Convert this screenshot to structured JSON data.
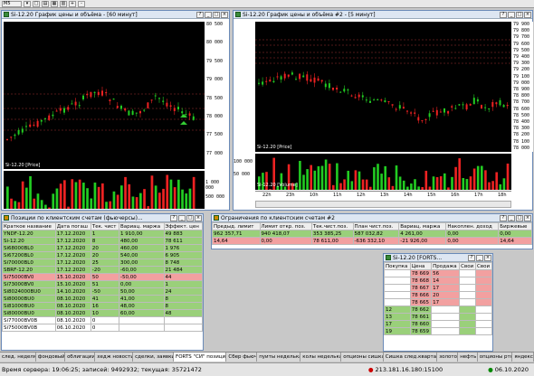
{
  "toolbar": {
    "combo": "M5"
  },
  "win1": {
    "title": "Si-12.20 График цены и объёма - [60 минут]",
    "price_label": "Si-12.20 [Price]",
    "vol_label": "Si-12.20 [Volume]",
    "axis": [
      "80 500",
      "80 000",
      "79 500",
      "79 000",
      "78 500",
      "78 000",
      "77 500",
      "77 000"
    ],
    "vol_axis": [
      "1 000 000",
      "500 000"
    ]
  },
  "win2": {
    "title": "Si-12.20 График цены и объёма #2 - [5 минут]",
    "price_label": "Si-12.20 [Price]",
    "vol_label": "Si-12.20 [Volume]",
    "axis": [
      "79 900",
      "79 800",
      "79 700",
      "79 600",
      "79 500",
      "79 400",
      "79 300",
      "79 200",
      "79 100",
      "79 000",
      "78 900",
      "78 800",
      "78 700",
      "78 600",
      "78 500",
      "78 400",
      "78 300",
      "78 200",
      "78 100",
      "78 000"
    ],
    "vol_axis": [
      "100 000",
      "50 000"
    ],
    "xticks": [
      "22h",
      "23h",
      "10h",
      "11h",
      "12h",
      "13h",
      "14h",
      "15h",
      "16h",
      "17h",
      "18h"
    ]
  },
  "positions": {
    "title": "Позиции по клиентским счетам (фьючерсы)...",
    "cols": [
      "Краткое название",
      "Дата погаш",
      "Тек. чист",
      "Вариац. маржа",
      "Эффект. цен"
    ],
    "rows": [
      [
        "YNDF-12.20",
        "17.12.2020",
        "1",
        "1 910,00",
        "49 883"
      ],
      [
        "Si-12.20",
        "17.12.2020",
        "8",
        "480,00",
        "78 611"
      ],
      [
        "Si68000BL0",
        "17.12.2020",
        "20",
        "460,00",
        "1 976"
      ],
      [
        "Si67200BL0",
        "17.12.2020",
        "20",
        "540,00",
        "6 905"
      ],
      [
        "Si70000BL0",
        "17.12.2020",
        "25",
        "300,00",
        "8 748"
      ],
      [
        "SBRF-12.20",
        "17.12.2020",
        "-20",
        "-60,00",
        "21 484"
      ],
      [
        "Si75000BV0",
        "15.10.2020",
        "50",
        "-50,00",
        "44"
      ],
      [
        "Si73000BV0",
        "15.10.2020",
        "51",
        "0,00",
        "1"
      ],
      [
        "Si8024000BU0",
        "14.10.2020",
        "-50",
        "50,00",
        "24"
      ],
      [
        "Si80000BU0",
        "08.10.2020",
        "41",
        "41,00",
        "8"
      ],
      [
        "Si81000BU0",
        "08.10.2020",
        "16",
        "48,00",
        "8"
      ],
      [
        "Si80000BU0",
        "08.10.2020",
        "10",
        "60,00",
        "48"
      ],
      [
        "Si77000BV0B",
        "08.10.2020",
        "0",
        "",
        ""
      ],
      [
        "Si75000BV0B",
        "06.10.2020",
        "0",
        "",
        ""
      ]
    ]
  },
  "limits": {
    "title": "Ограничения по клиентским счетам #2",
    "cols": [
      "Предыд. лимит",
      "Лимит откр. поз.",
      "Тек.чист.поз.",
      "План чист.поз.",
      "Вариац. маржа",
      "Накоплен. доход",
      "Биржевые"
    ],
    "rows": [
      [
        "962 357,71",
        "940 418,07",
        "353 385,25",
        "587 032,82",
        "4 261,00",
        "0,00",
        "0,00"
      ],
      [
        "14,64",
        "0,00",
        "78 611,00",
        "-636 332,10",
        "-21 926,00",
        "0,00",
        "14,64"
      ]
    ]
  },
  "dom": {
    "title": "Si-12.20 [FORTS...",
    "cols": [
      "Покупка",
      "Цена",
      "Продажа",
      "Свои",
      "Свои"
    ],
    "rows": [
      [
        "",
        "78 669",
        "56",
        "",
        ""
      ],
      [
        "",
        "78 668",
        "14",
        "",
        ""
      ],
      [
        "",
        "78 667",
        "17",
        "",
        ""
      ],
      [
        "",
        "78 666",
        "20",
        "",
        ""
      ],
      [
        "",
        "78 665",
        "17",
        "",
        ""
      ],
      [
        "12",
        "78 662",
        "",
        "",
        ""
      ],
      [
        "13",
        "78 661",
        "",
        "",
        ""
      ],
      [
        "17",
        "78 660",
        "",
        "",
        ""
      ],
      [
        "19",
        "78 659",
        "",
        "",
        ""
      ]
    ]
  },
  "tabs": [
    "FORTS \"СИ\" позиции",
    "Сбер фьюч",
    "пуиты неделька",
    "колы неделька",
    "опционы сишка",
    "Сишка след.квартал",
    "золото",
    "нефть",
    "опционы ртс",
    "яндекс"
  ],
  "left_tabs": [
    "след. неделя",
    "фондовый",
    "облигации",
    "хедж новости",
    "сделки, заявки"
  ],
  "status": {
    "server_time": "Время сервера: 19:06:25; записей: 9492932; текущая: 35721472",
    "ip": "213.181.16.180:15100",
    "date": "06.10.2020"
  }
}
